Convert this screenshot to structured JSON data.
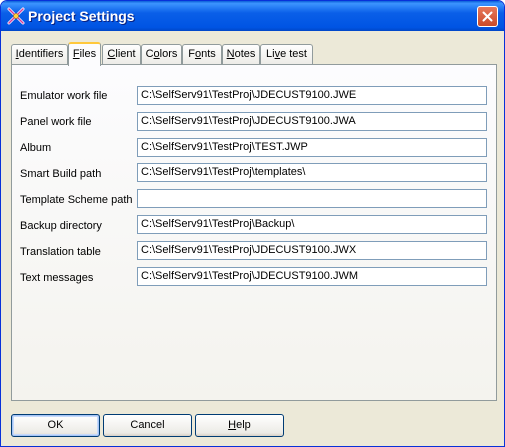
{
  "window": {
    "title": "Project Settings"
  },
  "tabs": [
    {
      "prefix": "",
      "mnemonic": "I",
      "rest": "dentifiers"
    },
    {
      "prefix": "",
      "mnemonic": "F",
      "rest": "iles"
    },
    {
      "prefix": "",
      "mnemonic": "C",
      "rest": "lient"
    },
    {
      "prefix": "C",
      "mnemonic": "o",
      "rest": "lors"
    },
    {
      "prefix": "F",
      "mnemonic": "o",
      "rest": "nts"
    },
    {
      "prefix": "",
      "mnemonic": "N",
      "rest": "otes"
    },
    {
      "prefix": "Li",
      "mnemonic": "v",
      "rest": "e test"
    }
  ],
  "active_tab": "Files",
  "fields": [
    {
      "label": "Emulator work file",
      "value": "C:\\SelfServ91\\TestProj\\JDECUST9100.JWE"
    },
    {
      "label": "Panel work file",
      "value": "C:\\SelfServ91\\TestProj\\JDECUST9100.JWA"
    },
    {
      "label": "Album",
      "value": "C:\\SelfServ91\\TestProj\\TEST.JWP"
    },
    {
      "label": "Smart Build path",
      "value": "C:\\SelfServ91\\TestProj\\templates\\"
    },
    {
      "label": "Template Scheme path",
      "value": ""
    },
    {
      "label": "Backup directory",
      "value": "C:\\SelfServ91\\TestProj\\Backup\\"
    },
    {
      "label": "Translation table",
      "value": "C:\\SelfServ91\\TestProj\\JDECUST9100.JWX"
    },
    {
      "label": "Text messages",
      "value": "C:\\SelfServ91\\TestProj\\JDECUST9100.JWM"
    }
  ],
  "buttons": {
    "ok": {
      "mnemonic": "",
      "rest": "OK"
    },
    "cancel": {
      "mnemonic": "",
      "rest": "Cancel"
    },
    "help": {
      "mnemonic": "H",
      "rest": "elp"
    }
  },
  "colors": {
    "titlebar": "#0054e3",
    "close": "#c94a2a",
    "tab_active_accent": "#ffc83c",
    "dialog_bg": "#ece9d8"
  },
  "icons": {
    "app": "app-logo-icon",
    "close": "close-icon"
  }
}
